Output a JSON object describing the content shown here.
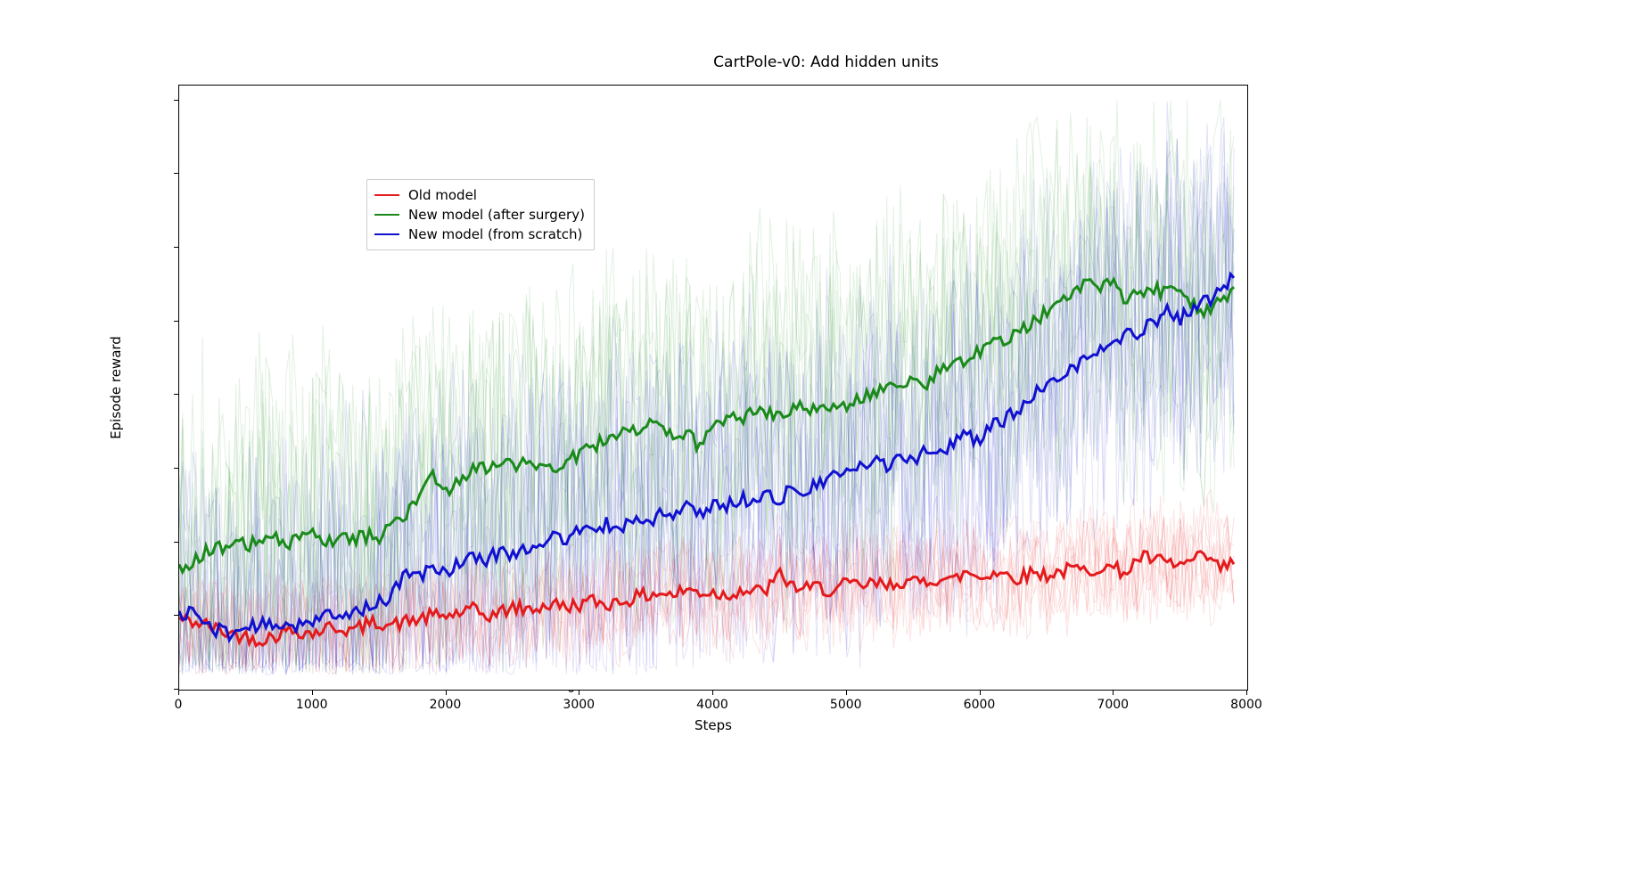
{
  "chart_data": {
    "type": "line",
    "title": "CartPole-v0: Add hidden units",
    "xlabel": "Steps",
    "ylabel": "Episode reward",
    "xlim": [
      0,
      8000
    ],
    "ylim": [
      0,
      205
    ],
    "x_ticks": [
      0,
      1000,
      2000,
      3000,
      4000,
      5000,
      6000,
      7000,
      8000
    ],
    "y_ticks": [
      0,
      25,
      50,
      75,
      100,
      125,
      150,
      175,
      200
    ],
    "x": [
      0,
      100,
      200,
      300,
      400,
      500,
      600,
      700,
      800,
      900,
      1000,
      1100,
      1200,
      1300,
      1400,
      1500,
      1600,
      1700,
      1800,
      1900,
      2000,
      2100,
      2200,
      2300,
      2400,
      2500,
      2600,
      2700,
      2800,
      2900,
      3000,
      3100,
      3200,
      3300,
      3400,
      3500,
      3600,
      3700,
      3800,
      3900,
      4000,
      4100,
      4200,
      4300,
      4400,
      4500,
      4600,
      4700,
      4800,
      4900,
      5000,
      5100,
      5200,
      5300,
      5400,
      5500,
      5600,
      5700,
      5800,
      5900,
      6000,
      6100,
      6200,
      6300,
      6400,
      6500,
      6600,
      6700,
      6800,
      6900,
      7000,
      7100,
      7200,
      7300,
      7400,
      7500,
      7600,
      7700,
      7800,
      7900
    ],
    "legend": {
      "position": "upper-left",
      "entries": [
        {
          "name": "Old model",
          "color": "#e41a1c"
        },
        {
          "name": "New model (after surgery)",
          "color": "#1a8a1a"
        },
        {
          "name": "New model (from scratch)",
          "color": "#1010d0"
        }
      ]
    },
    "series": [
      {
        "name": "Old model",
        "color": "#e41a1c",
        "values": [
          24,
          23,
          22,
          20,
          19,
          18,
          17,
          18,
          20,
          20,
          19,
          21,
          21,
          20,
          22,
          23,
          22,
          23,
          24,
          25,
          25,
          26,
          27,
          25,
          26,
          28,
          27,
          28,
          29,
          28,
          29,
          30,
          29,
          30,
          31,
          32,
          33,
          32,
          34,
          33,
          33,
          32,
          34,
          33,
          34,
          39,
          35,
          34,
          35,
          33,
          36,
          35,
          36,
          35,
          37,
          36,
          37,
          38,
          37,
          40,
          38,
          40,
          39,
          38,
          40,
          39,
          40,
          41,
          40,
          42,
          41,
          40,
          45,
          44,
          43,
          42,
          44,
          45,
          41,
          43
        ]
      },
      {
        "name": "New model (after surgery)",
        "color": "#1a8a1a",
        "values": [
          40,
          44,
          47,
          48,
          50,
          49,
          50,
          51,
          50,
          51,
          52,
          50,
          52,
          51,
          52,
          52,
          55,
          60,
          65,
          72,
          68,
          70,
          76,
          75,
          77,
          76,
          78,
          77,
          75,
          78,
          80,
          82,
          85,
          88,
          87,
          90,
          88,
          85,
          87,
          82,
          90,
          92,
          91,
          95,
          94,
          93,
          96,
          95,
          94,
          98,
          97,
          99,
          100,
          103,
          102,
          105,
          104,
          108,
          110,
          112,
          115,
          120,
          118,
          122,
          125,
          128,
          130,
          135,
          140,
          136,
          138,
          132,
          134,
          136,
          135,
          134,
          130,
          128,
          132,
          135
        ]
      },
      {
        "name": "New model (from scratch)",
        "color": "#1010d0",
        "values": [
          25,
          27,
          22,
          20,
          19,
          21,
          22,
          21,
          23,
          22,
          24,
          25,
          24,
          26,
          28,
          30,
          32,
          40,
          38,
          42,
          40,
          43,
          45,
          44,
          47,
          46,
          48,
          50,
          52,
          50,
          55,
          53,
          56,
          55,
          58,
          56,
          60,
          58,
          62,
          60,
          63,
          62,
          65,
          64,
          66,
          65,
          68,
          67,
          70,
          72,
          74,
          75,
          78,
          76,
          80,
          78,
          82,
          80,
          84,
          86,
          85,
          90,
          92,
          95,
          100,
          102,
          105,
          110,
          112,
          115,
          118,
          120,
          122,
          125,
          128,
          126,
          130,
          132,
          135,
          140
        ]
      }
    ],
    "background_series_note": "Multiple semi-transparent individual-run traces per color; only mean lines quantified."
  }
}
